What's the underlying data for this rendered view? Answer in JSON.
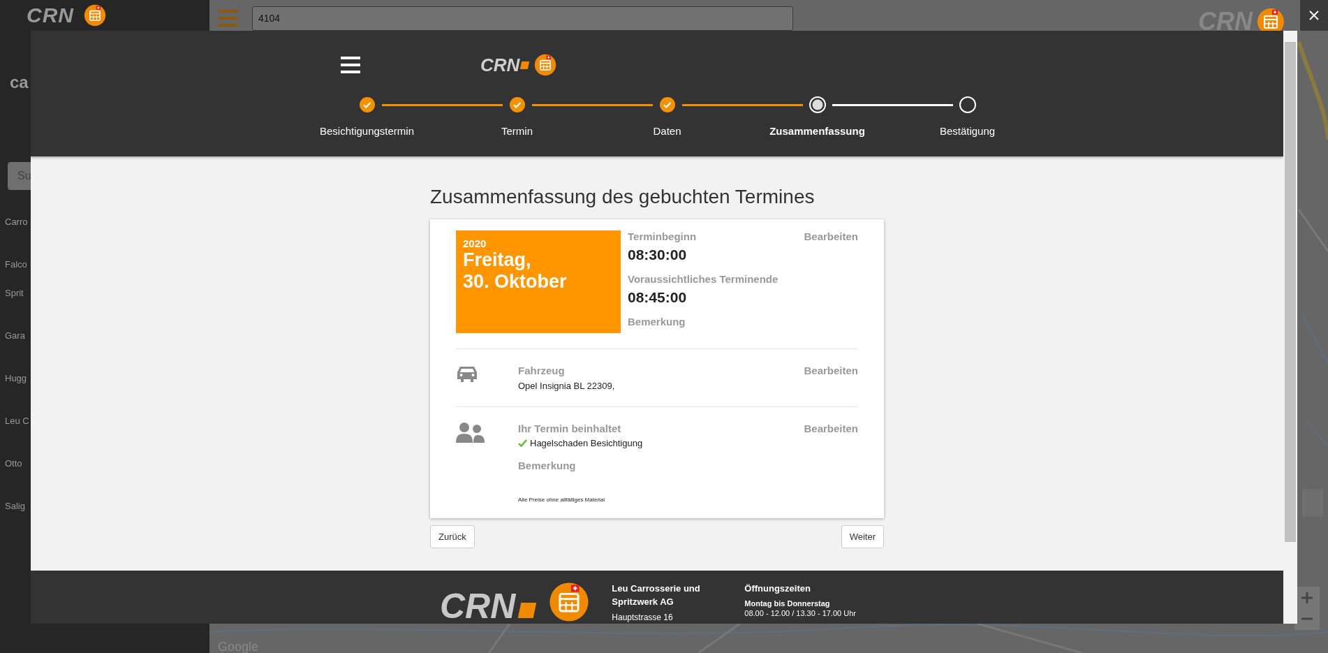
{
  "background": {
    "brand_left": "CRN",
    "brand_right": "CRN",
    "title": "ca",
    "search": {
      "value": "4104"
    },
    "button": "Su",
    "list": [
      {
        "lines": [
          "Carro"
        ]
      },
      {
        "lines": [
          "Falco",
          "Sprit"
        ]
      },
      {
        "lines": [
          "Gara"
        ]
      },
      {
        "lines": [
          "Hugg"
        ]
      },
      {
        "lines": [
          "Leu C"
        ]
      },
      {
        "lines": [
          "Otto"
        ]
      },
      {
        "lines": [
          "Salig"
        ]
      }
    ],
    "map_logo": "Google"
  },
  "modal": {
    "brand": "CRN",
    "steps": [
      {
        "label": "Besichtigungstermin",
        "completed": true,
        "selected": false
      },
      {
        "label": "Termin",
        "completed": true,
        "selected": false
      },
      {
        "label": "Daten",
        "completed": true,
        "selected": false
      },
      {
        "label": "Zusammenfassung",
        "completed": false,
        "selected": true
      },
      {
        "label": "Bestätigung",
        "completed": false,
        "selected": false
      }
    ],
    "title": "Zusammenfassung des gebuchten Termines",
    "summary": {
      "year": "2020",
      "weekday": "Freitag,",
      "day": "30. Oktober",
      "start_label": "Terminbeginn",
      "start": "08:30:00",
      "end_label": "Voraussichtliches Terminende",
      "end": "08:45:00",
      "remark_label": "Bemerkung",
      "edit": "Bearbeiten"
    },
    "sections": [
      {
        "kind": "vehicle",
        "label": "Fahrzeug",
        "edit": "Bearbeiten",
        "text": "Opel Insignia BL 22309,"
      },
      {
        "kind": "services",
        "label": "Ihr Termin beinhaltet",
        "edit": "Bearbeiten",
        "items": [
          {
            "text": "Hagelschaden Besichtigung",
            "checked": true
          }
        ],
        "remark_label": "Bemerkung",
        "note": "Alle Preise ohne allfälliges Material"
      }
    ],
    "buttons": {
      "back": "Zurück",
      "next": "Weiter"
    },
    "footer": {
      "brand": "CRN",
      "company": [
        "Leu Carrosserie und",
        "Spritzwerk AG"
      ],
      "address": "Hauptstrasse 16",
      "hours_title": "Öffnungszeiten",
      "days": "Montag bis Donnerstag",
      "hours": "08.00 - 12.00 / 13.30 - 17.00 Uhr"
    }
  }
}
